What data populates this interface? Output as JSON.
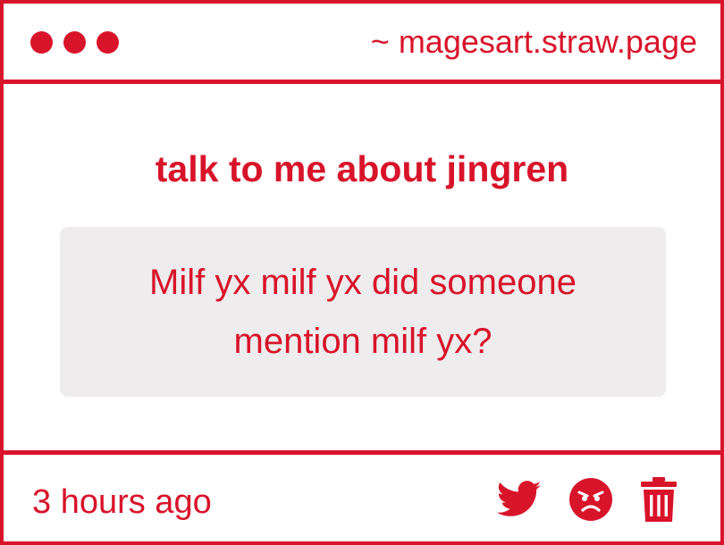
{
  "window": {
    "site": "~ magesart.straw.page"
  },
  "post": {
    "question": "talk to me about jingren",
    "answer": "Milf yx milf yx did someone mention milf yx?",
    "timestamp": "3 hours ago"
  },
  "actions": {
    "share_icon": "twitter-icon",
    "react_icon": "angry-face-icon",
    "delete_icon": "trash-icon"
  },
  "colors": {
    "accent": "#d8142a",
    "answer_background": "#eeeced",
    "background": "#ffffff"
  }
}
